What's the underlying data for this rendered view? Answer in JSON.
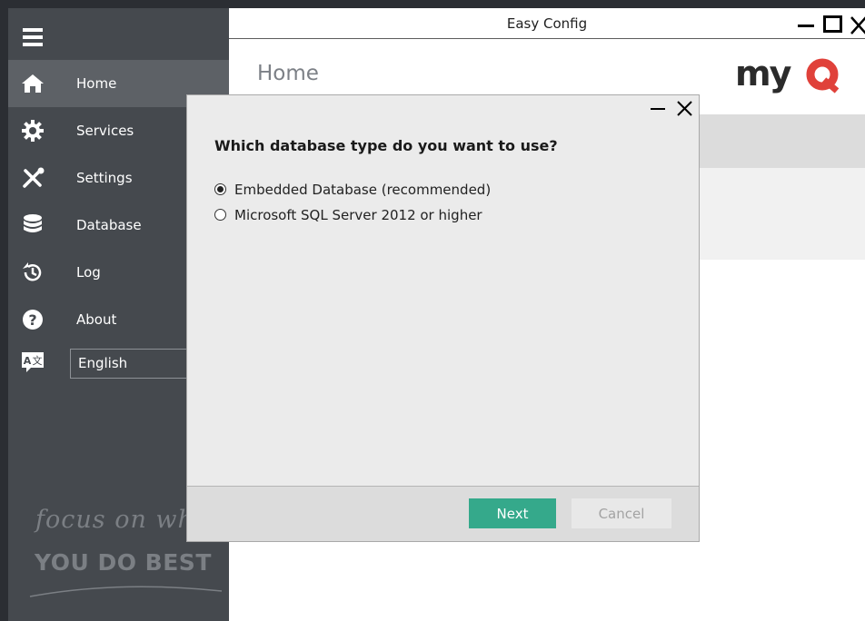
{
  "window": {
    "title": "Easy Config"
  },
  "sidebar": {
    "items": [
      {
        "label": "Home",
        "icon": "home-icon",
        "active": true
      },
      {
        "label": "Services",
        "icon": "gear-icon",
        "active": false
      },
      {
        "label": "Settings",
        "icon": "tools-icon",
        "active": false
      },
      {
        "label": "Database",
        "icon": "database-icon",
        "active": false
      },
      {
        "label": "Log",
        "icon": "history-icon",
        "active": false
      },
      {
        "label": "About",
        "icon": "help-icon",
        "active": false
      }
    ],
    "language": {
      "value": "English",
      "icon": "translate-icon"
    },
    "slogan_line1": "focus on what",
    "slogan_line2": "YOU DO BEST"
  },
  "main": {
    "page_title": "Home",
    "logo_text": "myQ"
  },
  "dialog": {
    "question": "Which database type do you want to use?",
    "options": [
      {
        "label": "Embedded Database (recommended)",
        "checked": true
      },
      {
        "label": "Microsoft SQL Server 2012 or higher",
        "checked": false
      }
    ],
    "next_label": "Next",
    "cancel_label": "Cancel"
  },
  "colors": {
    "sidebar_bg": "#45494e",
    "sidebar_active": "#5d6166",
    "accent_button": "#35a98b",
    "logo_red": "#e0413a",
    "dialog_bg": "#ebebeb"
  }
}
